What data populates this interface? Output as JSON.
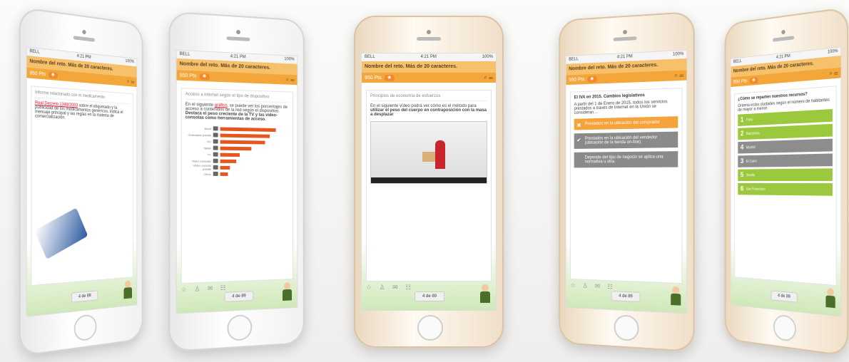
{
  "status": {
    "carrier": "BELL",
    "time": "4:21 PM",
    "battery": "100%"
  },
  "nav": {
    "title": "Nombre del reto. Más de 20 caracteres."
  },
  "points": "950 Pts",
  "pager": "4 de 89",
  "phone1": {
    "title": "Informe relacionado con el medicamento",
    "body_pre": "Real Decreto 1348/2003",
    "body": "sobre el etiquetado y la publicidad de los medicamentos genéricos. Indica el mensaje principal y las reglas en la materia de comercialización."
  },
  "phone2": {
    "title": "Acceso a internet según el tipo de dispositivo",
    "body_a": "En el siguiente ",
    "body_link": "gráfico",
    "body_b": ", se puede ver los porcentajes de acceso a contenidos de la red según el dispositivo. ",
    "body_bold": "Destaca el peso creciente de la TV y las video-consolas como herramientas de acceso.",
    "bars": [
      {
        "label": "Móvil",
        "value": 90
      },
      {
        "label": "Ordenador portátil",
        "value": 80
      },
      {
        "label": "PC",
        "value": 72
      },
      {
        "label": "Tablet",
        "value": 50
      },
      {
        "label": "TV",
        "value": 31
      },
      {
        "label": "Video consolas",
        "value": 25
      },
      {
        "label": "Video consola portátil",
        "value": 16
      },
      {
        "label": "Otros",
        "value": 12
      }
    ]
  },
  "phone3": {
    "title": "Principios de economía de esfuerzos",
    "body_a": "En el siguiente vídeo podrá ver cómo es el método para ",
    "body_bold": "utilizar el peso del cuerpo en contraposición con la masa a desplazar"
  },
  "phone4": {
    "title": "El IVA en 2015. Cambios legislativos",
    "body": "A partir del 1 de Enero de 2015, todos los servicios prestados a través de Internet en la Unión se consideran…",
    "options": [
      "Prestados en la ubicación del comprador",
      "Prestados en la ubicación del vendedor (ubicación de la tienda on-line)",
      "Depende del tipo de negocio se aplica una normativa u otra."
    ]
  },
  "phone5": {
    "title": "¿Cómo se reparten nuestros recursos?",
    "body": "Ordena estas ciudades según el número de habitantes de mayor a menor.",
    "items": [
      {
        "n": "1",
        "label": "Paris",
        "color": "green"
      },
      {
        "n": "2",
        "label": "Barcelona",
        "color": "green"
      },
      {
        "n": "4",
        "label": "Madrid",
        "color": "gray"
      },
      {
        "n": "3",
        "label": "El Cairo",
        "color": "gray"
      },
      {
        "n": "5",
        "label": "Sevilla",
        "color": "green"
      },
      {
        "n": "6",
        "label": "San Francisco",
        "color": "green"
      }
    ]
  }
}
